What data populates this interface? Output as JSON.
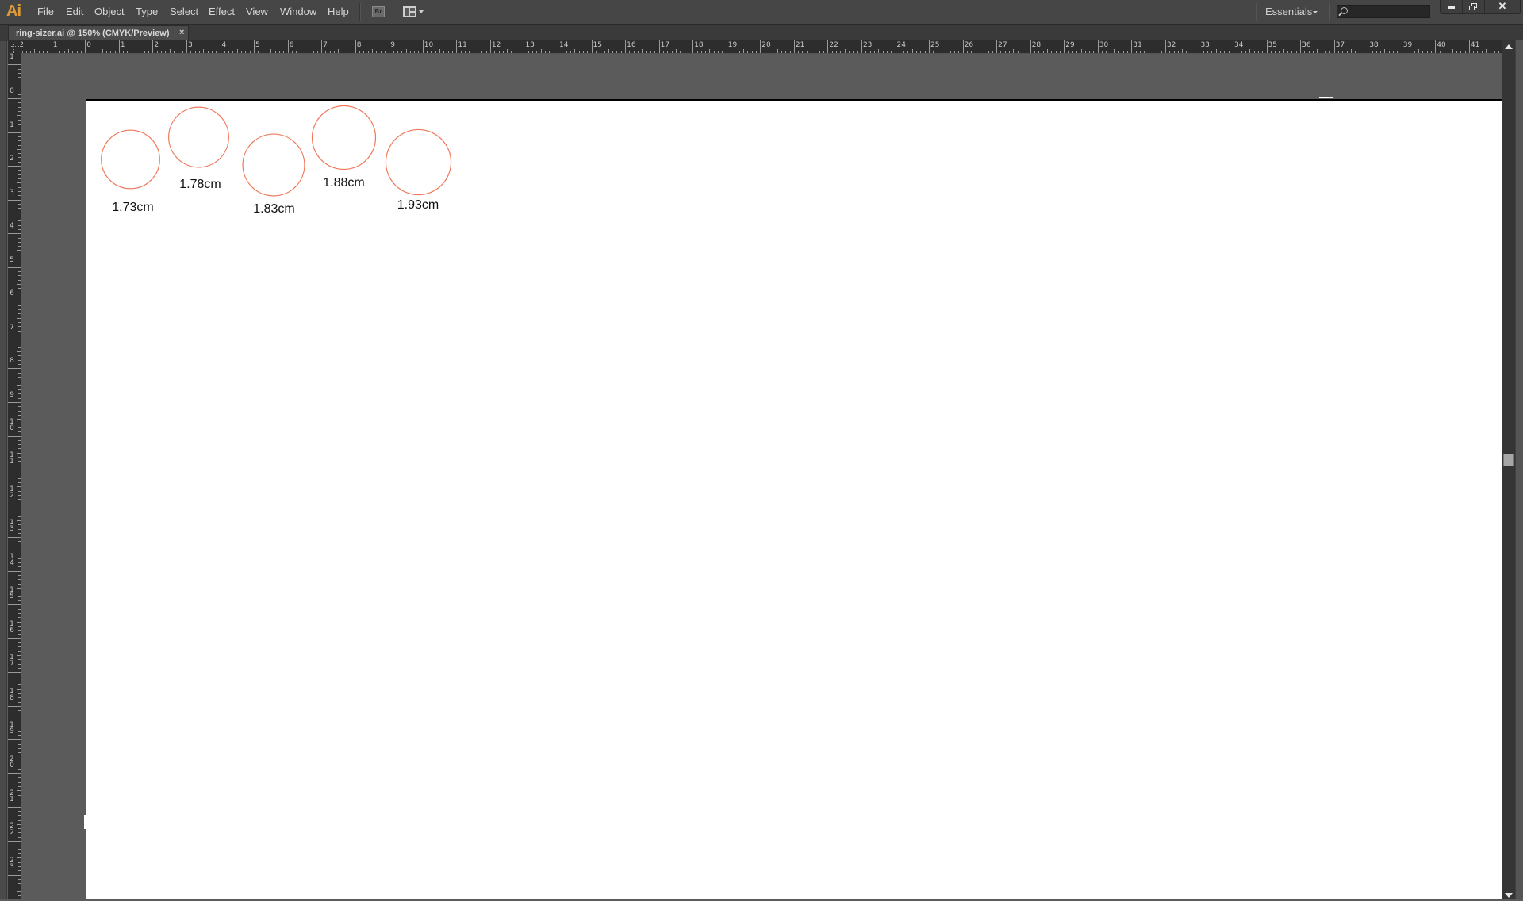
{
  "app": {
    "logo": "Ai",
    "menu": [
      "File",
      "Edit",
      "Object",
      "Type",
      "Select",
      "Effect",
      "View",
      "Window",
      "Help"
    ],
    "bridge_label": "Br",
    "workspace": "Essentials",
    "search_placeholder": ""
  },
  "window_controls": {
    "minimize": "minimize",
    "restore": "restore",
    "close": "✕"
  },
  "document": {
    "tab_title": "ring-sizer.ai @ 150% (CMYK/Preview)",
    "tab_close": "×",
    "zoom_percent": 150,
    "color_mode": "CMYK/Preview"
  },
  "rulers": {
    "unit": "cm",
    "horizontal_labels": [
      "2",
      "1",
      "0",
      "1",
      "2",
      "3",
      "4",
      "5",
      "6",
      "7",
      "8",
      "9",
      "10",
      "11",
      "12",
      "13",
      "14",
      "15",
      "16",
      "17",
      "18",
      "19",
      "20",
      "21",
      "22",
      "23",
      "24",
      "25",
      "26",
      "27",
      "28",
      "29",
      "30",
      "31",
      "32",
      "33",
      "34",
      "35",
      "36",
      "37",
      "38",
      "39",
      "40",
      "41"
    ],
    "vertical_labels": [
      "1",
      "0",
      "1",
      "2",
      "3",
      "4",
      "5",
      "6",
      "7",
      "8",
      "9",
      "10",
      "11",
      "12",
      "13",
      "14",
      "15",
      "16",
      "17",
      "18",
      "19",
      "20",
      "21",
      "22",
      "23"
    ]
  },
  "artboard": {
    "stroke_color": "#f0785a",
    "rings": [
      {
        "label": "1.73cm",
        "diameter_cm": 1.73
      },
      {
        "label": "1.78cm",
        "diameter_cm": 1.78
      },
      {
        "label": "1.83cm",
        "diameter_cm": 1.83
      },
      {
        "label": "1.88cm",
        "diameter_cm": 1.88
      },
      {
        "label": "1.93cm",
        "diameter_cm": 1.93
      }
    ]
  }
}
